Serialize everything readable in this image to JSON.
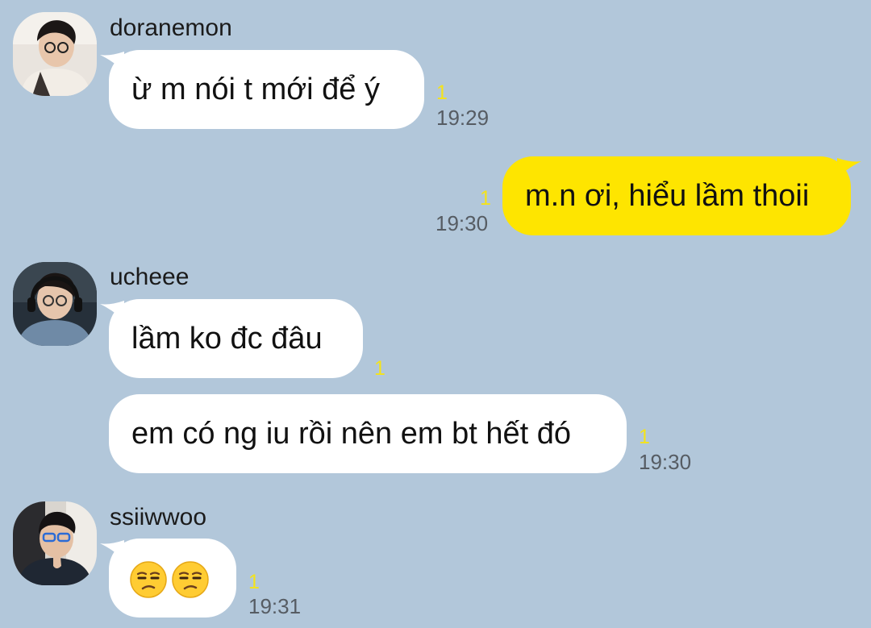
{
  "chat": {
    "messages": [
      {
        "sender": "doranemon",
        "avatar_icon": "user-avatar-icon",
        "text": "ừ m nói t mới để ý",
        "unread": "1",
        "time": "19:29"
      },
      {
        "sender": "me",
        "text": "m.n ơi, hiểu lầm thoii",
        "unread": "1",
        "time": "19:30"
      },
      {
        "sender": "ucheee",
        "avatar_icon": "user-avatar-icon",
        "text": "lầm ko đc đâu",
        "unread": "1"
      },
      {
        "sender": "ucheee",
        "text": "em có ng iu rồi nên em bt hết đó",
        "unread": "1",
        "time": "19:30"
      },
      {
        "sender": "ssiiwwoo",
        "avatar_icon": "user-avatar-icon",
        "emoji": [
          "unamused-face-icon",
          "unamused-face-icon"
        ],
        "unread": "1",
        "time": "19:31"
      }
    ]
  },
  "colors": {
    "background": "#b2c7da",
    "incoming_bubble": "#ffffff",
    "outgoing_bubble": "#fee500",
    "unread": "#f4e31b",
    "time": "#565c63"
  }
}
